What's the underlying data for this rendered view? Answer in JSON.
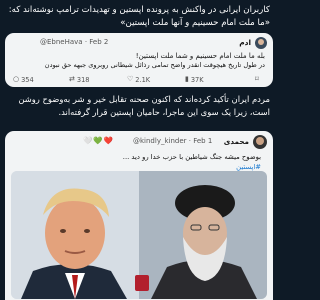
{
  "headline": "کاربران ایرانی در واکنش به پرونده اپستین و تهدیدات ترامپ نوشته‌اند که: «ما ملت امام حسینیم و آنها ملت اپستین»",
  "quote1": {
    "name": "ادم",
    "handle": "@EbneHava · Feb 2",
    "line1": "بله ما ملت امام حسینیم و شما ملت اپستین!",
    "line2": "در طول تاریخ هیچوقت انقدر واضح تمامی رذائل شیطانی روبروی جبهه حق نبودن",
    "stats": {
      "replies": "354",
      "reposts": "318",
      "likes": "2.1K",
      "views": "37K"
    },
    "icons": [
      "comment-icon",
      "repost-icon",
      "heart-icon",
      "chart-icon",
      "bookmark-icon"
    ]
  },
  "middle_text": "مردم ایران تأکید کرده‌اند که اکنون صحنه تقابل خیر و شر به‌وضوح روشن است، زیرا یک سوی این ماجرا، حامیان اپستین قرار گرفته‌اند.",
  "quote2": {
    "name": "محمدی",
    "hearts": "🤍💚❤️",
    "handle": "@kindly_kinder · Feb 1",
    "line1": "بوضوح میشه جنگ شیاطین با حزب خدا رو دید ...",
    "hashtag": "#اپستین"
  },
  "colors": {
    "background": "#0e1a26",
    "card": "#f2f4f5",
    "link": "#1d7bd1"
  }
}
